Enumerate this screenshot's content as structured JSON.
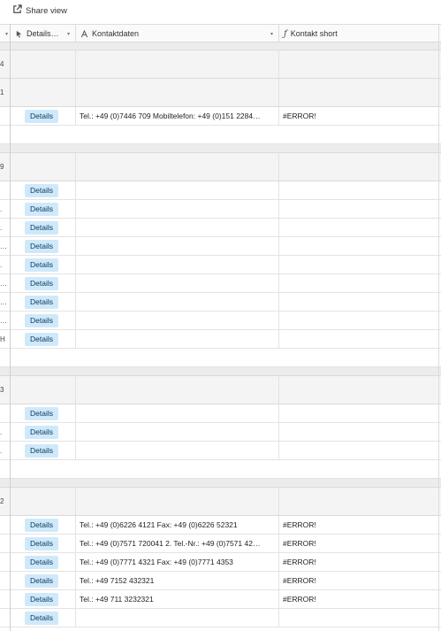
{
  "topbar": {
    "share_label": "Share view"
  },
  "columns": [
    {
      "label": "",
      "icon": "",
      "chevron": "▾"
    },
    {
      "label": "Details…",
      "icon": "cursor-icon",
      "chevron": "▾"
    },
    {
      "label": "Kontaktdaten",
      "icon": "text-field-icon",
      "chevron": "▾"
    },
    {
      "label": "Kontakt short",
      "icon": "formula-icon",
      "chevron": ""
    }
  ],
  "details_label": "Details",
  "rows": [
    {
      "type": "spacer",
      "h": 9
    },
    {
      "type": "group",
      "h": 32,
      "n": "4"
    },
    {
      "type": "group",
      "h": 32,
      "n": "1"
    },
    {
      "type": "record",
      "h": 21,
      "n": "",
      "btn": true,
      "contact": "Tel.: +49 (0)7446 709 Mobiltelefon: +49 (0)151 2284…",
      "short": "#ERROR!"
    },
    {
      "type": "blank",
      "h": 21
    },
    {
      "type": "spacer",
      "h": 10
    },
    {
      "type": "group",
      "h": 32,
      "n": "9"
    },
    {
      "type": "record",
      "h": 21,
      "n": "",
      "btn": true,
      "contact": "",
      "short": ""
    },
    {
      "type": "record",
      "h": 21,
      "n": ".",
      "btn": true,
      "contact": "",
      "short": ""
    },
    {
      "type": "record",
      "h": 21,
      "n": ".",
      "btn": true,
      "contact": "",
      "short": ""
    },
    {
      "type": "record",
      "h": 21,
      "n": "…",
      "btn": true,
      "contact": "",
      "short": ""
    },
    {
      "type": "record",
      "h": 21,
      "n": ".",
      "btn": true,
      "contact": "",
      "short": ""
    },
    {
      "type": "record",
      "h": 21,
      "n": "…",
      "btn": true,
      "contact": "",
      "short": ""
    },
    {
      "type": "record",
      "h": 21,
      "n": "…",
      "btn": true,
      "contact": "",
      "short": ""
    },
    {
      "type": "record",
      "h": 21,
      "n": "…",
      "btn": true,
      "contact": "",
      "short": ""
    },
    {
      "type": "record",
      "h": 21,
      "n": "H",
      "btn": true,
      "contact": "",
      "short": ""
    },
    {
      "type": "blank",
      "h": 21
    },
    {
      "type": "spacer",
      "h": 10
    },
    {
      "type": "group",
      "h": 32,
      "n": "3"
    },
    {
      "type": "record",
      "h": 21,
      "n": "",
      "btn": true,
      "contact": "",
      "short": ""
    },
    {
      "type": "record",
      "h": 21,
      "n": ".",
      "btn": true,
      "contact": "",
      "short": ""
    },
    {
      "type": "record",
      "h": 21,
      "n": ".",
      "btn": true,
      "contact": "",
      "short": ""
    },
    {
      "type": "blank",
      "h": 21
    },
    {
      "type": "spacer",
      "h": 10
    },
    {
      "type": "group",
      "h": 32,
      "n": "2"
    },
    {
      "type": "record",
      "h": 21,
      "n": "",
      "btn": true,
      "contact": "Tel.: +49 (0)6226 4121 Fax: +49 (0)6226 52321",
      "short": "#ERROR!"
    },
    {
      "type": "record",
      "h": 21,
      "n": "",
      "btn": true,
      "contact": "Tel.: +49 (0)7571 720041 2. Tel.-Nr.: +49 (0)7571 42…",
      "short": "#ERROR!"
    },
    {
      "type": "record",
      "h": 21,
      "n": "",
      "btn": true,
      "contact": "Tel.: +49 (0)7771 4321 Fax: +49 (0)7771 4353",
      "short": "#ERROR!"
    },
    {
      "type": "record",
      "h": 21,
      "n": "",
      "btn": true,
      "contact": "Tel.: +49 7152 432321",
      "short": "#ERROR!"
    },
    {
      "type": "record",
      "h": 21,
      "n": "",
      "btn": true,
      "contact": "Tel.: +49 711 3232321",
      "short": "#ERROR!"
    },
    {
      "type": "record",
      "h": 21,
      "n": "",
      "btn": true,
      "contact": "",
      "short": ""
    }
  ]
}
